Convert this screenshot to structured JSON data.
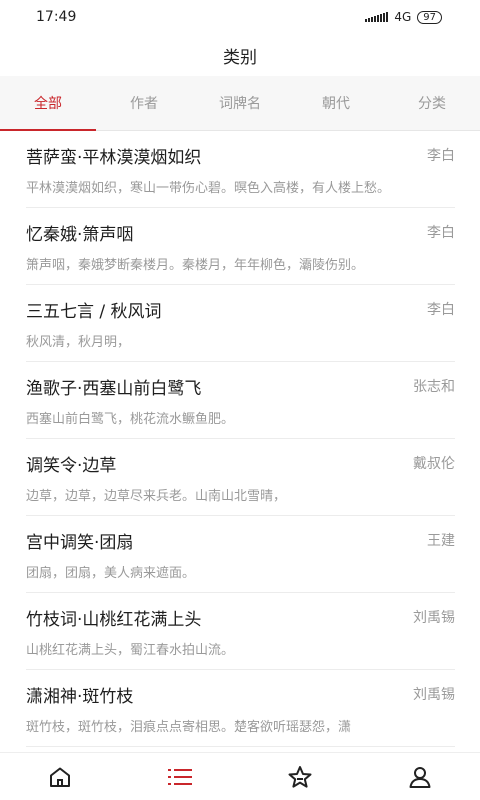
{
  "status_bar": {
    "time": "17:49",
    "network": "4G",
    "battery": "97"
  },
  "header": {
    "title": "类别"
  },
  "tabs": [
    {
      "label": "全部",
      "active": true
    },
    {
      "label": "作者",
      "active": false
    },
    {
      "label": "词牌名",
      "active": false
    },
    {
      "label": "朝代",
      "active": false
    },
    {
      "label": "分类",
      "active": false
    }
  ],
  "poems": [
    {
      "title": "菩萨蛮·平林漠漠烟如织",
      "author": "李白",
      "excerpt": "平林漠漠烟如织，寒山一带伤心碧。暝色入高楼，有人楼上愁。"
    },
    {
      "title": "忆秦娥·箫声咽",
      "author": "李白",
      "excerpt": "箫声咽，秦娥梦断秦楼月。秦楼月，年年柳色，灞陵伤别。"
    },
    {
      "title": "三五七言 / 秋风词",
      "author": "李白",
      "excerpt": "秋风清，秋月明，"
    },
    {
      "title": "渔歌子·西塞山前白鹭飞",
      "author": "张志和",
      "excerpt": "西塞山前白鹭飞，桃花流水鳜鱼肥。"
    },
    {
      "title": "调笑令·边草",
      "author": "戴叔伦",
      "excerpt": "边草，边草，边草尽来兵老。山南山北雪晴，"
    },
    {
      "title": "宫中调笑·团扇",
      "author": "王建",
      "excerpt": "团扇，团扇，美人病来遮面。"
    },
    {
      "title": "竹枝词·山桃红花满上头",
      "author": "刘禹锡",
      "excerpt": "山桃红花满上头，蜀江春水拍山流。"
    },
    {
      "title": "潇湘神·斑竹枝",
      "author": "刘禹锡",
      "excerpt": "斑竹枝，斑竹枝，泪痕点点寄相思。楚客欲听瑶瑟怨，潇"
    }
  ],
  "bottom_nav": {
    "items": [
      {
        "icon": "home-icon",
        "active": false
      },
      {
        "icon": "list-icon",
        "active": true
      },
      {
        "icon": "star-icon",
        "active": false
      },
      {
        "icon": "user-icon",
        "active": false
      }
    ]
  },
  "colors": {
    "accent": "#c9262b",
    "muted": "#9a9a9a",
    "text": "#1e1e1e"
  }
}
